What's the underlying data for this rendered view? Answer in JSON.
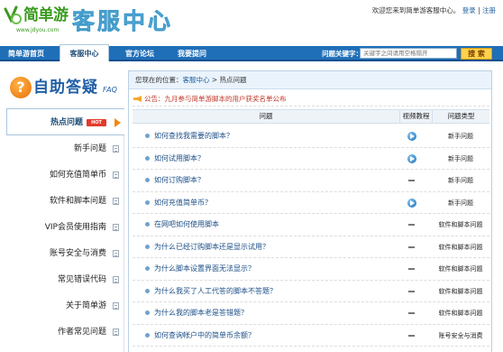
{
  "header": {
    "logo_text": "简单游",
    "logo_url": "www.jdyou.com",
    "title": "客服中心",
    "welcome": "欢迎您来到简单游客服中心。",
    "login": "登录",
    "separator": "|",
    "register": "注册"
  },
  "nav": {
    "items": [
      {
        "label": "简单游首页"
      },
      {
        "label": "客服中心"
      },
      {
        "label": "官方论坛"
      },
      {
        "label": "我要提问"
      }
    ],
    "keyword_label": "问题关键字：",
    "keyword_placeholder": "关键字之间请用空格隔开",
    "search_label": "搜 索"
  },
  "sidebar": {
    "icon": "question-icon",
    "title": "自助答疑",
    "title_suffix": "FAQ",
    "hot_badge": "HOT",
    "items": [
      {
        "label": "热点问题"
      },
      {
        "label": "新手问题"
      },
      {
        "label": "如何充值简单币"
      },
      {
        "label": "软件和脚本问题"
      },
      {
        "label": "VIP会员使用指南"
      },
      {
        "label": "账号安全与消费"
      },
      {
        "label": "常见错误代码"
      },
      {
        "label": "关于简单游"
      },
      {
        "label": "作者常见问题"
      }
    ]
  },
  "breadcrumb": {
    "prefix": "您现在的位置：",
    "home": "客服中心",
    "sep": " > ",
    "current": "热点问题"
  },
  "notice": "公告：九月参与简单游脚本的用户获奖名单公布",
  "table": {
    "headers": {
      "question": "问题",
      "video": "视频教程",
      "type": "问题类型"
    },
    "rows": [
      {
        "question": "如何查找我需要的脚本？",
        "video": "play",
        "type": "新手问题"
      },
      {
        "question": "如何试用脚本？",
        "video": "play",
        "type": "新手问题"
      },
      {
        "question": "如何订购脚本？",
        "video": "none",
        "type": "新手问题"
      },
      {
        "question": "如何充值简单币？",
        "video": "play",
        "type": "新手问题"
      },
      {
        "question": "在网吧如何使用脚本",
        "video": "none",
        "type": "软件和脚本问题"
      },
      {
        "question": "为什么已经订购脚本还是显示试用？",
        "video": "none",
        "type": "软件和脚本问题"
      },
      {
        "question": "为什么脚本设置界面无法显示？",
        "video": "none",
        "type": "软件和脚本问题"
      },
      {
        "question": "为什么我买了人工代答的脚本不答题？",
        "video": "none",
        "type": "软件和脚本问题"
      },
      {
        "question": "为什么我的脚本老是答错题？",
        "video": "none",
        "type": "软件和脚本问题"
      },
      {
        "question": "如何查询帐户中的简单币余额？",
        "video": "none",
        "type": "账号安全与消费"
      }
    ]
  },
  "colors": {
    "brand_green": "#3a9a1e",
    "nav_blue": "#1f6fb8",
    "link_blue": "#1c4f87",
    "notice_red": "#c0392b",
    "search_yellow": "#ffd24a"
  }
}
